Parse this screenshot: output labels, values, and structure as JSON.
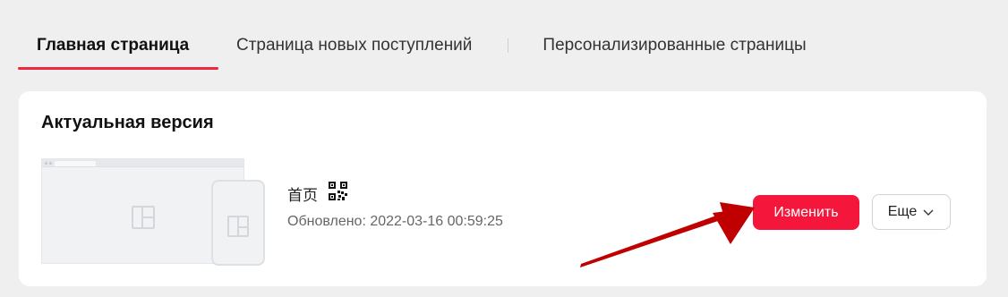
{
  "tabs": [
    {
      "label": "Главная страница",
      "active": true
    },
    {
      "label": "Страница новых поступлений",
      "active": false
    },
    {
      "label": "Персонализированные страницы",
      "active": false
    }
  ],
  "card": {
    "title": "Актуальная версия",
    "page": {
      "name": "首页",
      "updated": "Обновлено: 2022-03-16 00:59:25"
    },
    "actions": {
      "edit_label": "Изменить",
      "more_label": "Еще"
    }
  },
  "icons": {
    "qr": "qr-code-icon",
    "more_chevron": "chevron-down-icon",
    "layout": "layout-icon"
  },
  "colors": {
    "accent": "#f5163c",
    "tab_underline": "#f0283f",
    "annotation_arrow": "#c00000"
  }
}
